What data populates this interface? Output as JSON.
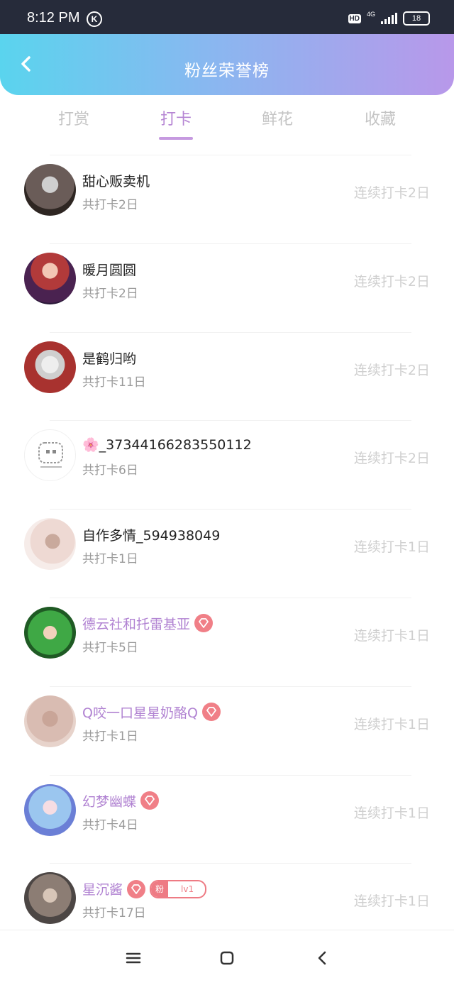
{
  "status_bar": {
    "time": "8:12 PM",
    "k_icon": "K",
    "hd": "HD",
    "network": "4G",
    "battery": "18"
  },
  "header": {
    "title": "粉丝荣誉榜"
  },
  "tabs": [
    {
      "label": "打赏"
    },
    {
      "label": "打卡"
    },
    {
      "label": "鲜花"
    },
    {
      "label": "收藏"
    }
  ],
  "active_tab": "打卡",
  "rows": [
    {
      "name": "甜心贩卖机",
      "total": "共打卡2日",
      "streak": "连续打卡2日"
    },
    {
      "name": "暖月圆圆",
      "total": "共打卡2日",
      "streak": "连续打卡2日"
    },
    {
      "name": "是鹤归哟",
      "total": "共打卡11日",
      "streak": "连续打卡2日"
    },
    {
      "name": "🌸_37344166283550112",
      "total": "共打卡6日",
      "streak": "连续打卡2日"
    },
    {
      "name": "自作多情_594938049",
      "total": "共打卡1日",
      "streak": "连续打卡1日"
    },
    {
      "name": "德云社和托雷基亚",
      "total": "共打卡5日",
      "streak": "连续打卡1日"
    },
    {
      "name": "Q咬一口星星奶酪Q",
      "total": "共打卡1日",
      "streak": "连续打卡1日"
    },
    {
      "name": "幻梦幽蝶",
      "total": "共打卡4日",
      "streak": "连续打卡1日"
    },
    {
      "name": "星沉酱",
      "total": "共打卡17日",
      "streak": "连续打卡1日",
      "fan_badge": {
        "left": "粉",
        "right": "lv1"
      }
    }
  ],
  "colors": {
    "accent": "#b686d4",
    "vip_name": "#b183d2",
    "gem": "#f07f87",
    "streak": "#cfcfcf",
    "header_start": "#5ad4ee",
    "header_end": "#b898ea"
  },
  "icons": {
    "back": "chevron-left-icon",
    "gem": "diamond-icon",
    "nav_menu": "menu-icon",
    "nav_home": "square-icon",
    "nav_back": "back-icon"
  }
}
